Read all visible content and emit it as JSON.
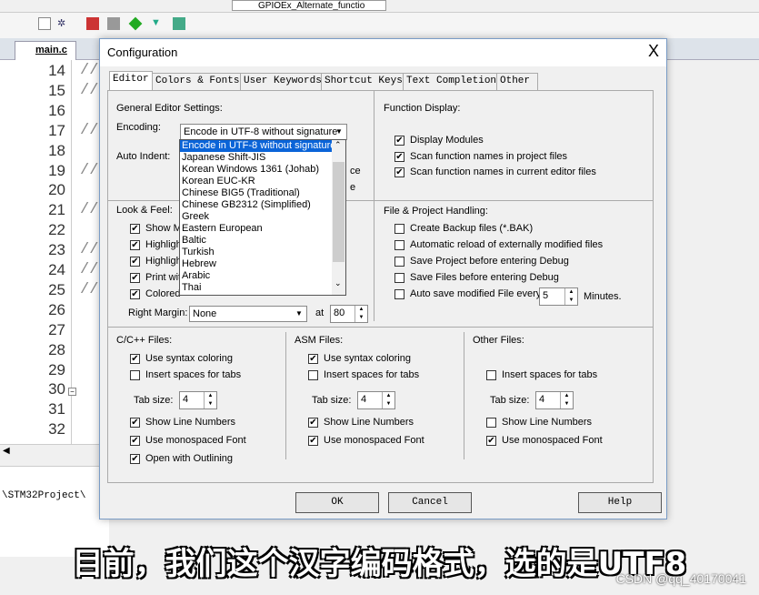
{
  "ide": {
    "toolbar_target": "GPIOEx_Alternate_functio",
    "file_tab": "main.c",
    "line_numbers": [
      "14",
      "15",
      "16",
      "17",
      "18",
      "19",
      "20",
      "21",
      "22",
      "23",
      "24",
      "25",
      "26",
      "27",
      "28",
      "29",
      "30",
      "31",
      "32"
    ],
    "comment_lines": [
      "//",
      "//",
      "",
      "//",
      "",
      "//",
      "",
      "//",
      "",
      "//",
      "//",
      "//",
      "",
      "",
      "",
      "",
      "",
      "",
      ""
    ],
    "status_path": "\\STM32Project\\"
  },
  "dialog": {
    "title": "Configuration",
    "close": "X",
    "tabs": [
      "Editor",
      "Colors & Fonts",
      "User Keywords",
      "Shortcut Keys",
      "Text Completion",
      "Other"
    ],
    "general": {
      "heading": "General Editor Settings:",
      "encoding_label": "Encoding:",
      "encoding_value": "Encode in UTF-8 without signature",
      "auto_indent_label": "Auto Indent:",
      "hidden_1": "ce",
      "hidden_2": "e"
    },
    "encoding_options": [
      "Encode in UTF-8 without signature",
      "Japanese Shift-JIS",
      "Korean Windows 1361 (Johab)",
      "Korean EUC-KR",
      "Chinese BIG5 (Traditional)",
      "Chinese GB2312 (Simplified)",
      "Greek",
      "Eastern European",
      "Baltic",
      "Turkish",
      "Hebrew",
      "Arabic",
      "Thai"
    ],
    "look": {
      "heading": "Look & Feel:",
      "items": [
        {
          "label": "Show M",
          "checked": true
        },
        {
          "label": "Highligh",
          "checked": true
        },
        {
          "label": "Highligh",
          "checked": true
        },
        {
          "label": "Print wit",
          "checked": true
        },
        {
          "label": "Colored",
          "checked": true
        }
      ],
      "right_margin_label": "Right Margin:",
      "right_margin_value": "None",
      "at_label": "at",
      "at_value": "80"
    },
    "function_display": {
      "heading": "Function Display:",
      "items": [
        {
          "label": "Display Modules",
          "checked": true
        },
        {
          "label": "Scan function names in project files",
          "checked": true
        },
        {
          "label": "Scan function names in current editor files",
          "checked": true
        }
      ]
    },
    "file_project": {
      "heading": "File & Project Handling:",
      "items": [
        {
          "label": "Create Backup files (*.BAK)",
          "checked": false
        },
        {
          "label": "Automatic reload of externally modified files",
          "checked": false
        },
        {
          "label": "Save Project before entering Debug",
          "checked": false
        },
        {
          "label": "Save Files before entering Debug",
          "checked": false
        },
        {
          "label": "Auto save modified File every",
          "checked": false
        }
      ],
      "autosave_value": "5",
      "autosave_unit": "Minutes."
    },
    "c_files": {
      "heading": "C/C++ Files:",
      "syntax": "Use syntax coloring",
      "syntax_checked": true,
      "spaces": "Insert spaces for tabs",
      "spaces_checked": false,
      "tab_size_label": "Tab size:",
      "tab_size": "4",
      "line_numbers": "Show Line Numbers",
      "line_numbers_checked": true,
      "mono": "Use monospaced Font",
      "mono_checked": true,
      "outlining": "Open with Outlining",
      "outlining_checked": true
    },
    "asm_files": {
      "heading": "ASM Files:",
      "syntax": "Use syntax coloring",
      "syntax_checked": true,
      "spaces": "Insert spaces for tabs",
      "spaces_checked": false,
      "tab_size_label": "Tab size:",
      "tab_size": "4",
      "line_numbers": "Show Line Numbers",
      "line_numbers_checked": true,
      "mono": "Use monospaced Font",
      "mono_checked": true
    },
    "other_files": {
      "heading": "Other Files:",
      "spaces": "Insert spaces for tabs",
      "spaces_checked": false,
      "tab_size_label": "Tab size:",
      "tab_size": "4",
      "line_numbers": "Show Line Numbers",
      "line_numbers_checked": false,
      "mono": "Use monospaced Font",
      "mono_checked": true
    },
    "buttons": {
      "ok": "OK",
      "cancel": "Cancel",
      "help": "Help"
    }
  },
  "subtitle": "目前，我们这个汉字编码格式，选的是UTF8",
  "watermark": "CSDN @qq_40170041",
  "colors": {
    "selection": "#0a64d8",
    "dialog_border": "#7a9cc6"
  }
}
